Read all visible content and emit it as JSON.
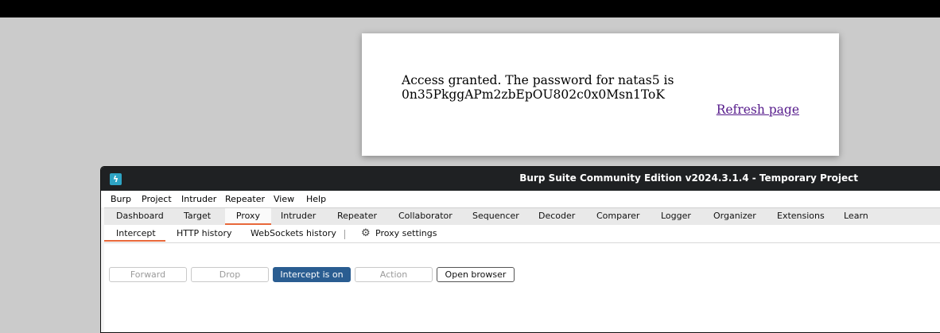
{
  "web_page": {
    "message_line1": "Access granted. The password for natas5 is",
    "message_line2": "0n35PkggAPm2zbEpOU802c0x0Msn1ToK",
    "refresh_link": "Refresh page"
  },
  "burp": {
    "app_icon": "burp-lightning-icon",
    "title": "Burp Suite Community Edition v2024.3.1.4 - Temporary Project",
    "menu": [
      "Burp",
      "Project",
      "Intruder",
      "Repeater",
      "View",
      "Help"
    ],
    "tabs": [
      "Dashboard",
      "Target",
      "Proxy",
      "Intruder",
      "Repeater",
      "Collaborator",
      "Sequencer",
      "Decoder",
      "Comparer",
      "Logger",
      "Organizer",
      "Extensions",
      "Learn"
    ],
    "active_tab": "Proxy",
    "subtabs": [
      "Intercept",
      "HTTP history",
      "WebSockets history"
    ],
    "active_subtab": "Intercept",
    "proxy_settings_label": "Proxy settings",
    "proxy_settings_icon": "gear-icon",
    "buttons": {
      "forward": "Forward",
      "drop": "Drop",
      "intercept": "Intercept is on",
      "action": "Action",
      "open_browser": "Open browser"
    },
    "colors": {
      "accent": "#e8683a",
      "intercept_button": "#2a5d91",
      "titlebar": "#1f2123"
    }
  }
}
